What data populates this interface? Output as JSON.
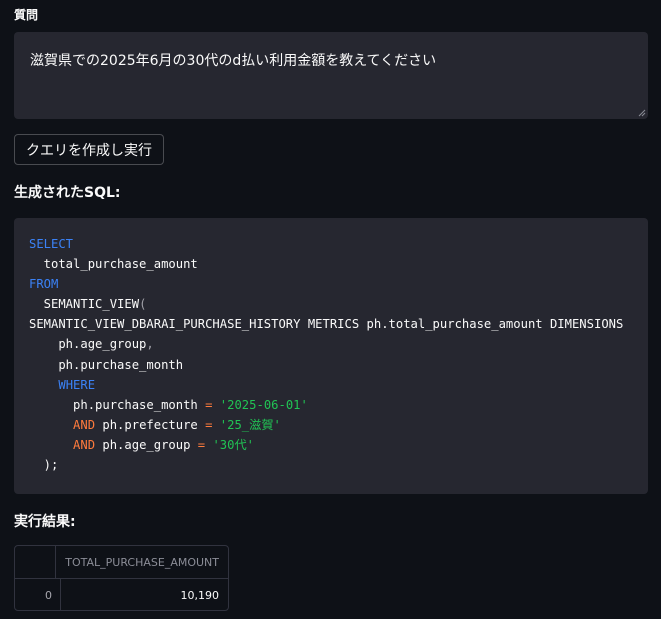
{
  "question": {
    "label": "質問",
    "value": "滋賀県での2025年6月の30代のd払い利用金額を教えてください"
  },
  "run_button": {
    "label": "クエリを作成し実行"
  },
  "sql": {
    "heading": "生成されたSQL:",
    "lines": [
      [
        {
          "t": "SELECT",
          "c": "kw"
        }
      ],
      [
        {
          "t": "  total_purchase_amount"
        }
      ],
      [
        {
          "t": "FROM",
          "c": "kw"
        }
      ],
      [
        {
          "t": "  SEMANTIC_VIEW"
        },
        {
          "t": "(",
          "c": "punc"
        }
      ],
      [
        {
          "t": "SEMANTIC_VIEW_DBARAI_PURCHASE_HISTORY METRICS ph.total_purchase_amount DIMENSIONS"
        }
      ],
      [
        {
          "t": "    ph.age_group"
        },
        {
          "t": ",",
          "c": "punc"
        }
      ],
      [
        {
          "t": "    ph.purchase_month"
        }
      ],
      [
        {
          "t": "    "
        },
        {
          "t": "WHERE",
          "c": "kw"
        }
      ],
      [
        {
          "t": "      ph.purchase_month "
        },
        {
          "t": "=",
          "c": "op"
        },
        {
          "t": " "
        },
        {
          "t": "'2025-06-01'",
          "c": "str"
        }
      ],
      [
        {
          "t": "      "
        },
        {
          "t": "AND",
          "c": "op"
        },
        {
          "t": " ph.prefecture "
        },
        {
          "t": "=",
          "c": "op"
        },
        {
          "t": " "
        },
        {
          "t": "'25_滋賀'",
          "c": "str"
        }
      ],
      [
        {
          "t": "      "
        },
        {
          "t": "AND",
          "c": "op"
        },
        {
          "t": " ph.age_group "
        },
        {
          "t": "=",
          "c": "op"
        },
        {
          "t": " "
        },
        {
          "t": "'30代'",
          "c": "str"
        }
      ],
      [
        {
          "t": "  );"
        }
      ]
    ]
  },
  "result": {
    "heading": "実行結果:",
    "columns": [
      "",
      "TOTAL_PURCHASE_AMOUNT"
    ],
    "rows": [
      [
        "0",
        "10,190"
      ]
    ]
  }
}
